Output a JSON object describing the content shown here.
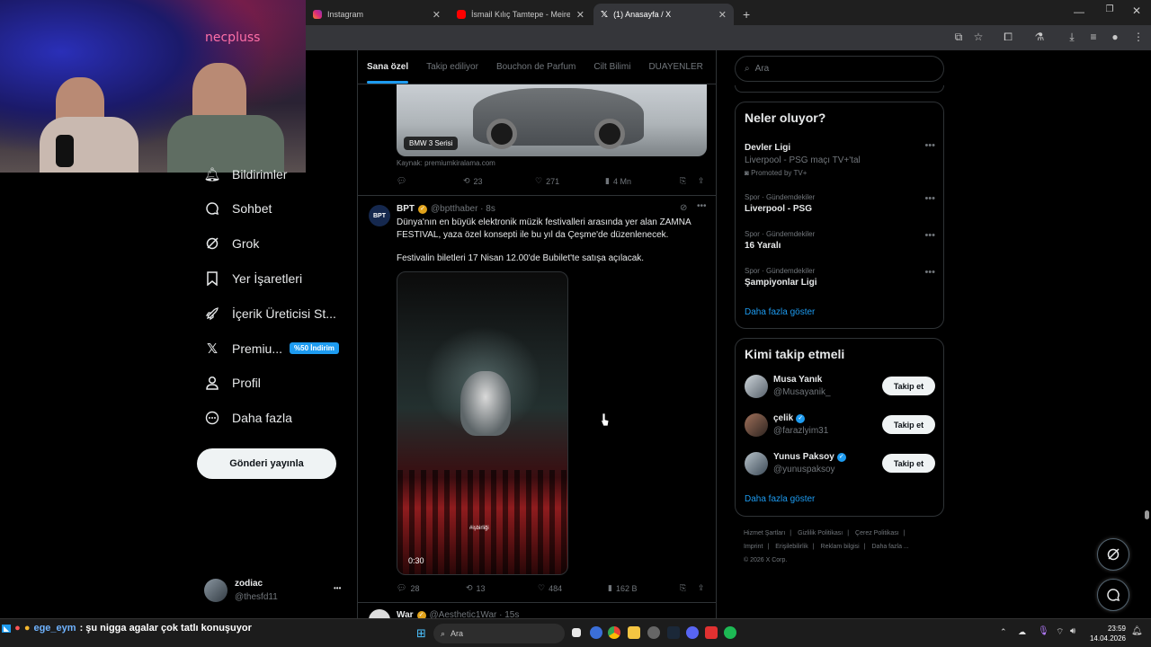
{
  "browser": {
    "tabs": [
      {
        "label": "Instagram",
        "active": false
      },
      {
        "label": "İsmail Kılıç Tamtepe - Meireles S",
        "active": false
      },
      {
        "label": "(1) Anasayfa / X",
        "active": true
      }
    ],
    "new_tab": "+"
  },
  "webcam": {
    "overlay_logo": "necpluss"
  },
  "nav": {
    "items": [
      {
        "label": "Bildirimler",
        "icon": "bell-icon"
      },
      {
        "label": "Sohbet",
        "icon": "chat-icon"
      },
      {
        "label": "Grok",
        "icon": "grok-icon"
      },
      {
        "label": "Yer İşaretleri",
        "icon": "bookmark-icon"
      },
      {
        "label": "İçerik Üreticisi St...",
        "icon": "rocket-icon"
      },
      {
        "label": "Premiu...",
        "icon": "x-logo-icon"
      },
      {
        "label": "Profil",
        "icon": "person-icon"
      },
      {
        "label": "Daha fazla",
        "icon": "more-circle-icon"
      }
    ],
    "premium_badge": "%50 İndirim",
    "post_button": "Gönderi yayınla",
    "account": {
      "name": "zodiac",
      "handle": "@thesfd11",
      "more": "•••"
    }
  },
  "feed": {
    "tabs": [
      "Sana özel",
      "Takip ediliyor",
      "Bouchon de Parfum",
      "Cilt Bilimi",
      "DUAYENLER"
    ],
    "tweet1": {
      "image_label": "BMW 3 Serisi",
      "source": "Kaynak: premiumkiralama.com",
      "retweets": "23",
      "likes": "271",
      "views": "4 Mn"
    },
    "tweet2": {
      "name": "BPT",
      "handle": "@bptthaber · 8s",
      "avatar_text": "BPT",
      "text1": "Dünya'nın en büyük elektronik müzik festivalleri arasında yer alan ZAMNA FESTIVAL, yaza özel konsepti ile bu yıl da Çeşme'de düzenlenecek.",
      "text2": "Festivalin biletleri 17 Nisan 12.00'de Bubilet'te satışa açılacak.",
      "video_duration": "0:30",
      "video_watermark": "#işbirliği",
      "replies": "28",
      "retweets": "13",
      "likes": "484",
      "views": "162 B"
    },
    "tweet3": {
      "name": "War",
      "handle": "@Aesthetic1War · 15s"
    }
  },
  "sidebar": {
    "search_placeholder": "Ara",
    "trends_title": "Neler oluyor?",
    "trends": [
      {
        "meta": "",
        "name": "Devler Ligi",
        "sub": "Liverpool - PSG maçı TV+'tal",
        "promo": "Promoted by TV+"
      },
      {
        "meta": "Spor · Gündemdekiler",
        "name": "Liverpool - PSG",
        "sub": "",
        "promo": ""
      },
      {
        "meta": "Spor · Gündemdekiler",
        "name": "16 Yaralı",
        "sub": "",
        "promo": ""
      },
      {
        "meta": "Spor · Gündemdekiler",
        "name": "Şampiyonlar Ligi",
        "sub": "",
        "promo": ""
      }
    ],
    "trends_more": "Daha fazla göster",
    "follow_title": "Kimi takip etmeli",
    "follow": [
      {
        "name": "Musa Yanık",
        "handle": "@Musayanik_",
        "verified": false,
        "button": "Takip et"
      },
      {
        "name": "çelik",
        "handle": "@farazlyim31",
        "verified": true,
        "button": "Takip et"
      },
      {
        "name": "Yunus Paksoy",
        "handle": "@yunuspaksoy",
        "verified": true,
        "button": "Takip et"
      }
    ],
    "follow_more": "Daha fazla göster",
    "footer": [
      "Hizmet Şartları",
      "|",
      "Gizlilik Politikası",
      "|",
      "Çerez Politikası",
      "|",
      "Imprint",
      "|",
      "Erişilebilirlik",
      "|",
      "Reklam bilgisi",
      "|",
      "Daha fazla ...",
      "© 2026 X Corp."
    ]
  },
  "taskbar": {
    "chat_user": "ege_eym",
    "chat_message": ": şu nigga agalar çok tatlı konuşuyor",
    "search_placeholder": "Ara",
    "time": "23:59",
    "date": "14.04.2026"
  },
  "colors": {
    "accent": "#1d9bf0",
    "background": "#000000",
    "border": "#2f3336",
    "muted": "#71767b"
  }
}
